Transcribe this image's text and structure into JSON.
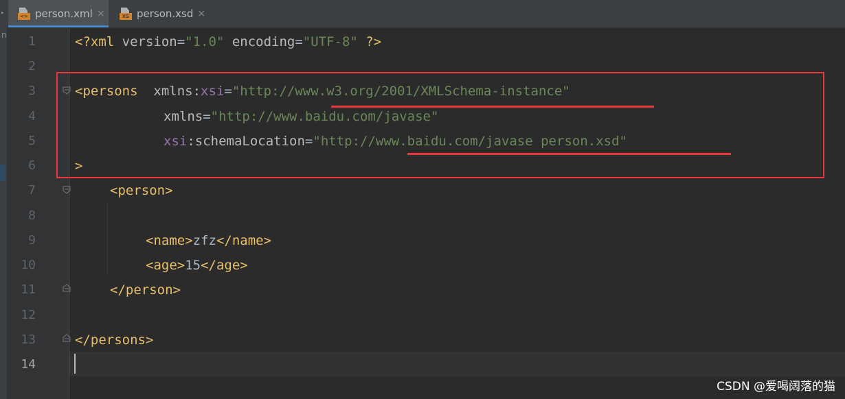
{
  "tabs": [
    {
      "label": "person.xml",
      "icon": "xml-file-icon",
      "badge": "<>",
      "active": true
    },
    {
      "label": "person.xsd",
      "icon": "xsd-file-icon",
      "badge": "XS",
      "active": false
    }
  ],
  "side_panel_glyph": "n",
  "line_numbers": [
    "1",
    "2",
    "3",
    "4",
    "5",
    "6",
    "7",
    "8",
    "9",
    "10",
    "11",
    "12",
    "13",
    "14"
  ],
  "code": {
    "l1": [
      "<?xml",
      " version",
      "=",
      "\"1.0\"",
      " encoding",
      "=",
      "\"UTF-8\"",
      " ?>"
    ],
    "l3": [
      "<persons",
      "  xmlns",
      ":",
      "xsi",
      "=",
      "\"http://www.w3.org/2001/XMLSchema-instance\""
    ],
    "l4": [
      "xmlns",
      "=",
      "\"http://www.baidu.com/javase\""
    ],
    "l5": [
      "xsi",
      ":",
      "schemaLocation",
      "=",
      "\"http://www.baidu.com/javase person.xsd\""
    ],
    "l6": [
      ">"
    ],
    "l7": [
      "<person>"
    ],
    "l9": [
      "<name>",
      "zfz",
      "</name>"
    ],
    "l10": [
      "<age>",
      "15",
      "</age>"
    ],
    "l11": [
      "</person>"
    ],
    "l13": [
      "</persons>"
    ]
  },
  "watermark": "CSDN @爱喝阔落的猫",
  "colors": {
    "editor_bg": "#2b2b2b",
    "tag": "#e8bf6a",
    "attribute": "#bababa",
    "namespace_prefix": "#9876aa",
    "string": "#6a8759",
    "annotation_red": "#e8383d"
  }
}
